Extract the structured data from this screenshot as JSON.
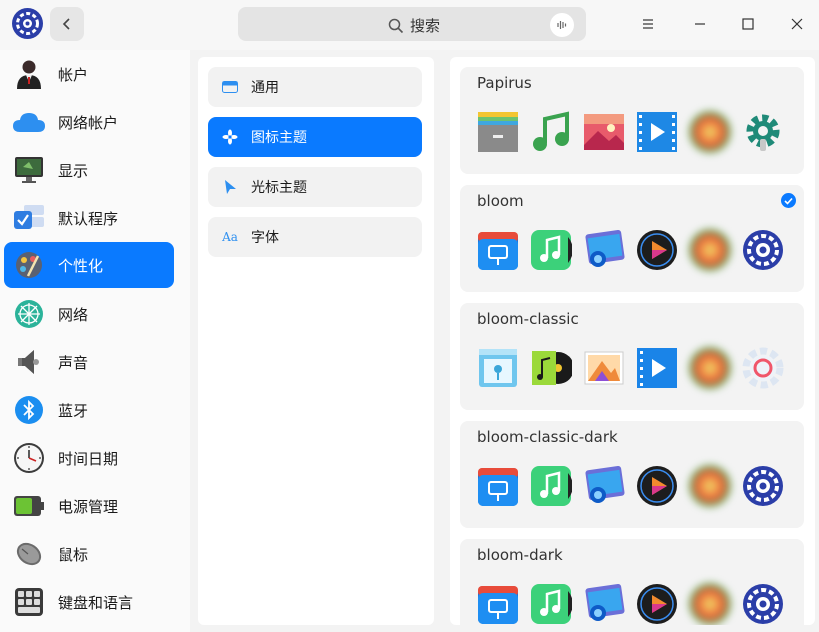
{
  "titlebar": {
    "search_placeholder": "搜索",
    "icons": [
      "app-logo-icon",
      "back-icon",
      "search-icon",
      "voice-icon",
      "menu-icon",
      "minimize-icon",
      "maximize-icon",
      "close-icon"
    ]
  },
  "sidebar": {
    "items": [
      {
        "label": "帐户",
        "icon": "account-icon"
      },
      {
        "label": "网络帐户",
        "icon": "cloud-icon"
      },
      {
        "label": "显示",
        "icon": "display-icon"
      },
      {
        "label": "默认程序",
        "icon": "default-apps-icon"
      },
      {
        "label": "个性化",
        "icon": "personalization-icon",
        "active": true
      },
      {
        "label": "网络",
        "icon": "network-icon"
      },
      {
        "label": "声音",
        "icon": "sound-icon"
      },
      {
        "label": "蓝牙",
        "icon": "bluetooth-icon"
      },
      {
        "label": "时间日期",
        "icon": "clock-icon"
      },
      {
        "label": "电源管理",
        "icon": "battery-icon"
      },
      {
        "label": "鼠标",
        "icon": "mouse-icon"
      },
      {
        "label": "键盘和语言",
        "icon": "keyboard-icon"
      }
    ]
  },
  "submenu": {
    "items": [
      {
        "label": "通用",
        "icon": "general-icon"
      },
      {
        "label": "图标主题",
        "icon": "icon-theme-icon",
        "active": true
      },
      {
        "label": "光标主题",
        "icon": "cursor-icon"
      },
      {
        "label": "字体",
        "icon": "font-icon",
        "icon_text": "Aa"
      }
    ]
  },
  "themes": [
    {
      "name": "Papirus",
      "selected": false
    },
    {
      "name": "bloom",
      "selected": true
    },
    {
      "name": "bloom-classic",
      "selected": false
    },
    {
      "name": "bloom-classic-dark",
      "selected": false
    },
    {
      "name": "bloom-dark",
      "selected": false
    }
  ],
  "colors": {
    "accent": "#0a7aff"
  }
}
